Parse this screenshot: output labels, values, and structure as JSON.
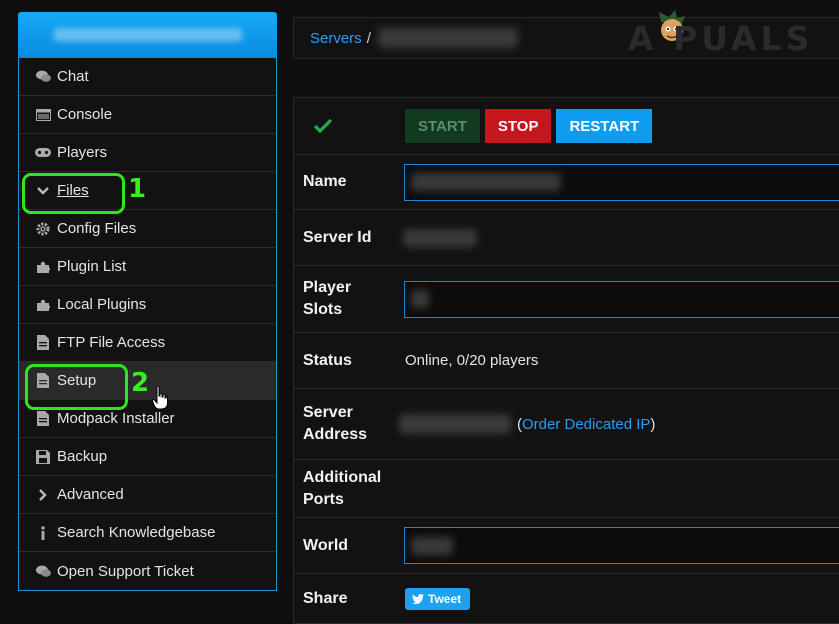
{
  "sidebar": {
    "items": [
      {
        "label": "Chat",
        "icon": "chat-icon"
      },
      {
        "label": "Console",
        "icon": "console-icon"
      },
      {
        "label": "Players",
        "icon": "gamepad-icon"
      },
      {
        "label": "Files",
        "icon": "chevron-down-icon"
      },
      {
        "label": "Config Files",
        "icon": "gear-icon"
      },
      {
        "label": "Plugin List",
        "icon": "puzzle-icon"
      },
      {
        "label": "Local Plugins",
        "icon": "puzzle-icon"
      },
      {
        "label": "FTP File Access",
        "icon": "file-icon"
      },
      {
        "label": "Setup",
        "icon": "file-icon"
      },
      {
        "label": "Modpack Installer",
        "icon": "file-icon"
      },
      {
        "label": "Backup",
        "icon": "floppy-icon"
      },
      {
        "label": "Advanced",
        "icon": "chevron-right-icon"
      },
      {
        "label": "Search Knowledgebase",
        "icon": "info-icon"
      },
      {
        "label": "Open Support Ticket",
        "icon": "chat-icon"
      }
    ]
  },
  "annotations": {
    "step1": "1",
    "step2": "2"
  },
  "breadcrumb": {
    "root": "Servers",
    "separator": "/"
  },
  "logo": {
    "text": "A PUALS"
  },
  "controls": {
    "start": "START",
    "stop": "STOP",
    "restart": "RESTART"
  },
  "fields": {
    "name_label": "Name",
    "server_id_label": "Server Id",
    "player_slots_label": "Player Slots",
    "status_label": "Status",
    "status_value": "Online, 0/20 players",
    "server_address_label": "Server Address",
    "order_ip_link": "Order Dedicated IP",
    "additional_ports_label": "Additional Ports",
    "world_label": "World",
    "share_label": "Share",
    "tweet_label": "Tweet"
  },
  "colors": {
    "accent": "#0e9cf0",
    "stop": "#c4161c",
    "start": "#123a20",
    "highlight": "#2ee81f",
    "success": "#1ea84a"
  }
}
